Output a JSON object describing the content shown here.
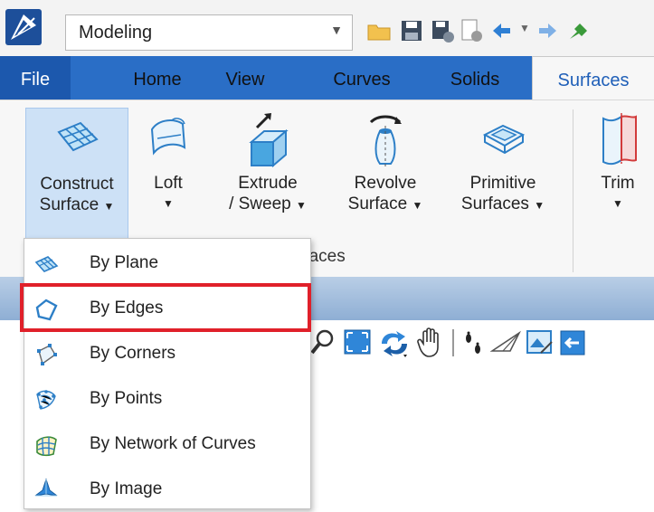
{
  "titlebar": {
    "workflow_value": "Modeling",
    "quick_access_icons": [
      "open-folder-icon",
      "save-icon",
      "save-settings-icon",
      "properties-icon",
      "undo-icon",
      "redo-icon",
      "pin-icon"
    ]
  },
  "tabs": [
    {
      "label": "File",
      "active": false
    },
    {
      "label": "Home",
      "active": false
    },
    {
      "label": "View",
      "active": false
    },
    {
      "label": "Curves",
      "active": false
    },
    {
      "label": "Solids",
      "active": false
    },
    {
      "label": "Surfaces",
      "active": true
    }
  ],
  "ribbon": {
    "group_label": "rfaces",
    "buttons": [
      {
        "line1": "Construct",
        "line2": "Surface",
        "caret": "▼",
        "icon": "construct-surface-icon"
      },
      {
        "line1": "Loft",
        "line2": "",
        "caret": "▼",
        "icon": "loft-icon"
      },
      {
        "line1": "Extrude",
        "line2": "/ Sweep",
        "caret": "▼",
        "icon": "extrude-icon"
      },
      {
        "line1": "Revolve",
        "line2": "Surface",
        "caret": "▼",
        "icon": "revolve-icon"
      },
      {
        "line1": "Primitive",
        "line2": "Surfaces",
        "caret": "▼",
        "icon": "primitive-surfaces-icon"
      },
      {
        "line1": "Trim",
        "line2": "",
        "caret": "▼",
        "icon": "trim-icon"
      }
    ]
  },
  "menu": {
    "items": [
      {
        "label": "By Plane",
        "icon": "by-plane-icon"
      },
      {
        "label": "By Edges",
        "icon": "by-edges-icon",
        "highlighted": true
      },
      {
        "label": "By Corners",
        "icon": "by-corners-icon"
      },
      {
        "label": "By Points",
        "icon": "by-points-icon"
      },
      {
        "label": "By Network of Curves",
        "icon": "by-network-icon"
      },
      {
        "label": "By Image",
        "icon": "by-image-icon"
      }
    ]
  },
  "colors": {
    "tab_bar": "#2a6ec6",
    "file_tab": "#1c58ad",
    "highlight_border": "#e0202a",
    "selected_button": "#cde1f6"
  }
}
